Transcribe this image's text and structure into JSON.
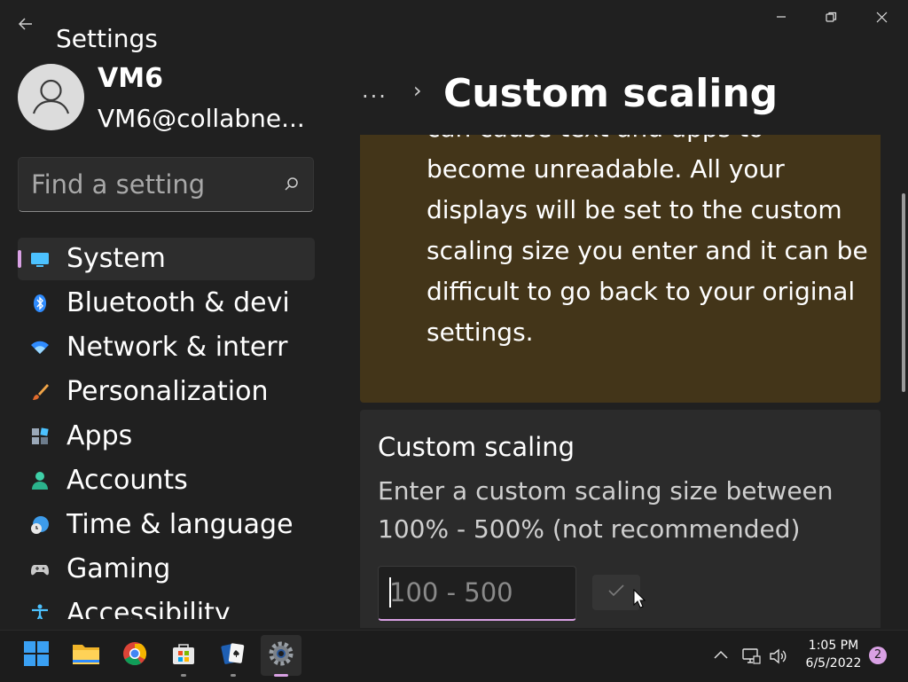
{
  "window": {
    "title": "Settings",
    "back_icon": "back-arrow-icon",
    "controls": [
      "minimize-icon",
      "restore-icon",
      "close-icon"
    ]
  },
  "profile": {
    "name": "VM6",
    "email": "VM6@collabne..."
  },
  "search": {
    "placeholder": "Find a setting",
    "value": "",
    "icon": "search-icon"
  },
  "nav": {
    "selected": "System",
    "items": [
      {
        "label": "System",
        "icon": "system-icon"
      },
      {
        "label": "Bluetooth & devi",
        "icon": "bluetooth-icon"
      },
      {
        "label": "Network & interr",
        "icon": "network-icon"
      },
      {
        "label": "Personalization",
        "icon": "brush-icon"
      },
      {
        "label": "Apps",
        "icon": "apps-icon"
      },
      {
        "label": "Accounts",
        "icon": "accounts-icon"
      },
      {
        "label": "Time & language",
        "icon": "time-language-icon"
      },
      {
        "label": "Gaming",
        "icon": "gaming-icon"
      },
      {
        "label": "Accessibility",
        "icon": "accessibility-icon"
      }
    ]
  },
  "breadcrumb": {
    "more": "...",
    "separator": "›",
    "title": "Custom scaling"
  },
  "warning": {
    "text": "can cause text and apps to become unreadable. All your displays will be set to the custom scaling size you enter and it can be difficult to go back to your original settings."
  },
  "custom_scaling": {
    "title": "Custom scaling",
    "description": "Enter a custom scaling size between 100% - 500% (not recommended)",
    "input_placeholder": "100 - 500",
    "input_value": "",
    "apply_icon": "checkmark-icon"
  },
  "taskbar": {
    "apps": [
      {
        "name": "Start",
        "icon": "windows-start-icon"
      },
      {
        "name": "File Explorer",
        "icon": "folder-icon"
      },
      {
        "name": "Chrome",
        "icon": "chrome-icon"
      },
      {
        "name": "Microsoft Store",
        "icon": "store-icon"
      },
      {
        "name": "Solitaire",
        "icon": "cards-icon"
      },
      {
        "name": "Settings",
        "icon": "settings-gear-icon"
      }
    ],
    "tray_icons": [
      "chevron-up-icon",
      "network-icon",
      "volume-icon"
    ],
    "time": "1:05 PM",
    "date": "6/5/2022",
    "notification_count": "2"
  },
  "colors": {
    "background": "#202020",
    "accent": "#d9a1e4",
    "warning_bg": "#433519",
    "card_bg": "#2b2b2b"
  }
}
